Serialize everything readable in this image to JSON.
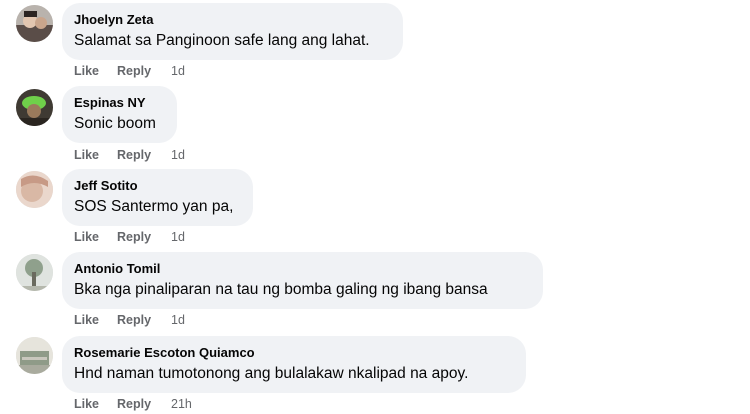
{
  "comments": [
    {
      "author": "Jhoelyn Zeta",
      "text": "Salamat sa Panginoon safe lang ang lahat.",
      "like_label": "Like",
      "reply_label": "Reply",
      "time": "1d",
      "avatar_icon": "profile-photo"
    },
    {
      "author": "Espinas NY",
      "text": "Sonic boom",
      "like_label": "Like",
      "reply_label": "Reply",
      "time": "1d",
      "avatar_icon": "profile-photo"
    },
    {
      "author": "Jeff Sotito",
      "text": "SOS Santermo yan pa,",
      "like_label": "Like",
      "reply_label": "Reply",
      "time": "1d",
      "avatar_icon": "profile-photo"
    },
    {
      "author": "Antonio Tomil",
      "text": "Bka nga pinaliparan na tau ng bomba galing ng ibang bansa",
      "like_label": "Like",
      "reply_label": "Reply",
      "time": "1d",
      "avatar_icon": "profile-photo"
    },
    {
      "author": "Rosemarie Escoton Quiamco",
      "text": "Hnd naman tumotonong ang bulalakaw nkalipad na apoy.",
      "like_label": "Like",
      "reply_label": "Reply",
      "time": "21h",
      "avatar_icon": "profile-photo"
    }
  ],
  "colors": {
    "bubble_bg": "#f0f2f5",
    "text": "#050505",
    "secondary_text": "#65676b"
  }
}
